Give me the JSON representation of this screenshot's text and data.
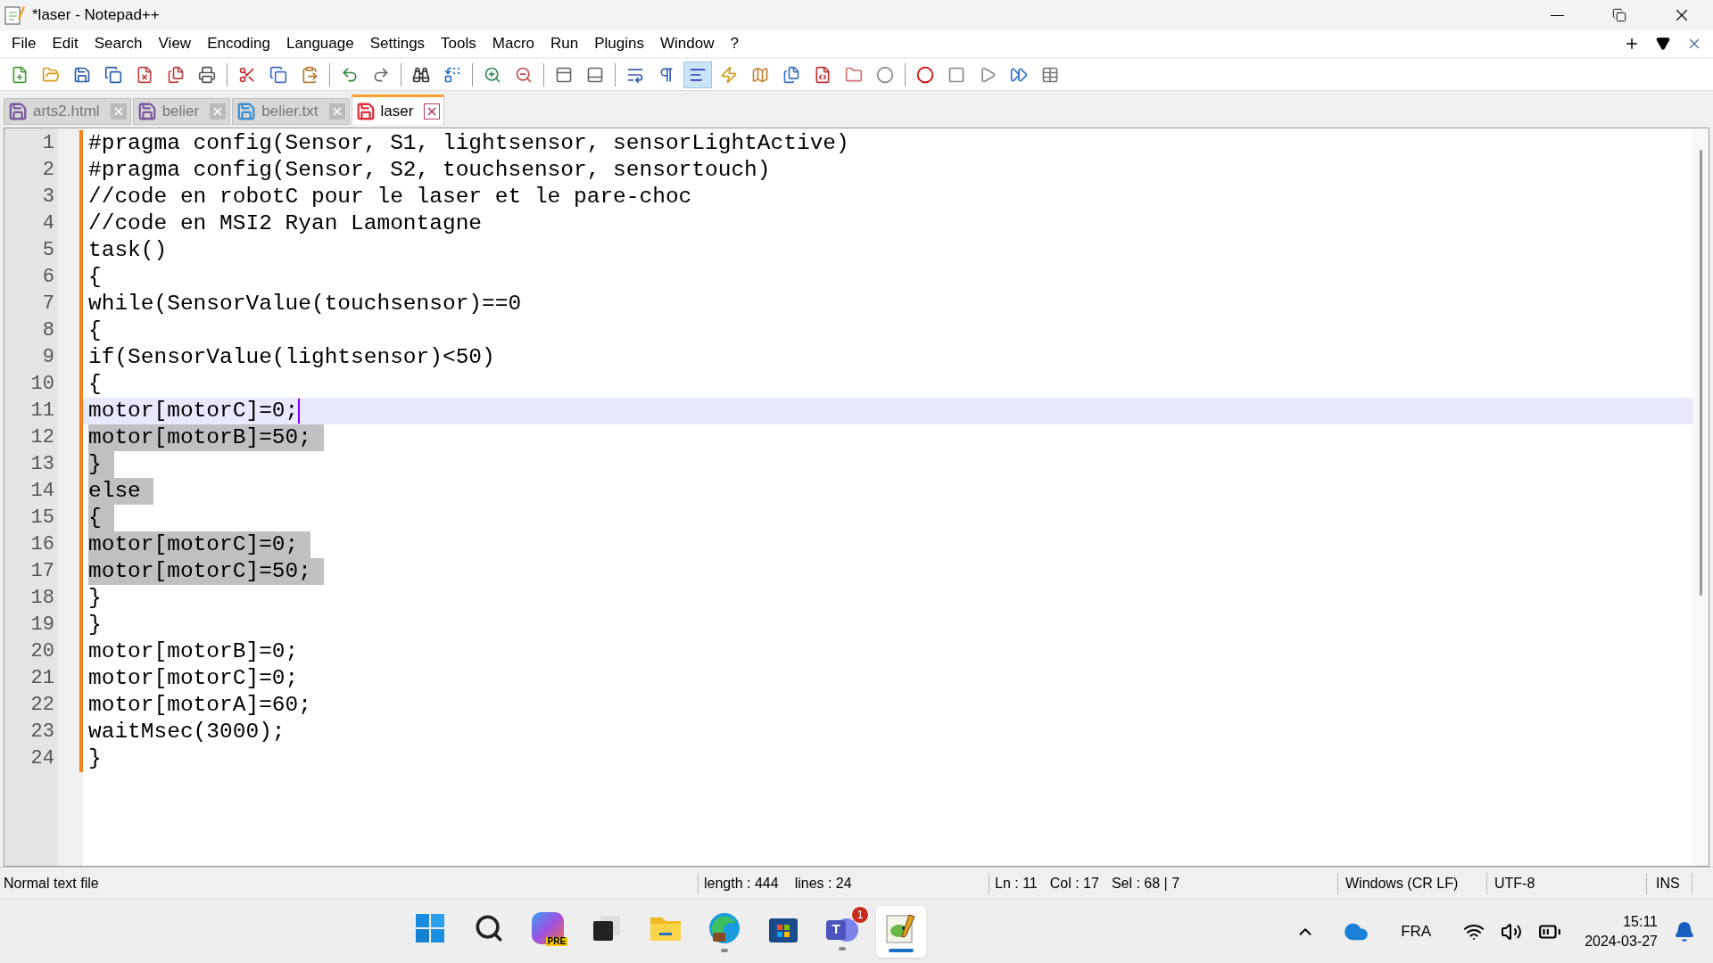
{
  "window": {
    "title": "*laser - Notepad++"
  },
  "menu": [
    "File",
    "Edit",
    "Search",
    "View",
    "Encoding",
    "Language",
    "Settings",
    "Tools",
    "Macro",
    "Run",
    "Plugins",
    "Window",
    "?"
  ],
  "toolbar": [
    {
      "kind": "button",
      "pressed": false
    },
    {
      "kind": "button",
      "pressed": false
    },
    {
      "kind": "button",
      "pressed": false
    },
    {
      "kind": "button",
      "pressed": false
    },
    {
      "kind": "button",
      "pressed": false
    },
    {
      "kind": "button",
      "pressed": false
    },
    {
      "kind": "button",
      "pressed": false
    },
    {
      "kind": "separator"
    },
    {
      "kind": "button",
      "pressed": false
    },
    {
      "kind": "button",
      "pressed": false
    },
    {
      "kind": "button",
      "pressed": false
    },
    {
      "kind": "separator"
    },
    {
      "kind": "button",
      "pressed": false
    },
    {
      "kind": "button",
      "pressed": false
    },
    {
      "kind": "separator"
    },
    {
      "kind": "button",
      "pressed": false
    },
    {
      "kind": "button",
      "pressed": false
    },
    {
      "kind": "separator"
    },
    {
      "kind": "button",
      "pressed": false
    },
    {
      "kind": "button",
      "pressed": false
    },
    {
      "kind": "separator"
    },
    {
      "kind": "button",
      "pressed": false
    },
    {
      "kind": "button",
      "pressed": false
    },
    {
      "kind": "separator"
    },
    {
      "kind": "button",
      "pressed": false
    },
    {
      "kind": "button",
      "pressed": false
    },
    {
      "kind": "button",
      "pressed": true
    },
    {
      "kind": "button",
      "pressed": false
    },
    {
      "kind": "button",
      "pressed": false
    },
    {
      "kind": "button",
      "pressed": false
    },
    {
      "kind": "button",
      "pressed": false
    },
    {
      "kind": "button",
      "pressed": false
    },
    {
      "kind": "button",
      "pressed": false
    },
    {
      "kind": "separator"
    },
    {
      "kind": "button",
      "pressed": false
    },
    {
      "kind": "button",
      "pressed": false
    },
    {
      "kind": "button",
      "pressed": false
    },
    {
      "kind": "button",
      "pressed": false
    },
    {
      "kind": "button",
      "pressed": false
    }
  ],
  "tabs": [
    {
      "label": "arts2.html",
      "selected": false,
      "color": "#7a5a9e"
    },
    {
      "label": "belier",
      "selected": false,
      "color": "#7a5a9e"
    },
    {
      "label": "belier.txt",
      "selected": false,
      "color": "#3a8fd0"
    },
    {
      "label": "laser",
      "selected": true,
      "color": "#e0303a"
    }
  ],
  "lines": [
    {
      "number": "1",
      "text": "#pragma config(Sensor, S1, lightsensor, sensorLightActive)",
      "selected": false,
      "current": false
    },
    {
      "number": "2",
      "text": "#pragma config(Sensor, S2, touchsensor, sensortouch)",
      "selected": false,
      "current": false
    },
    {
      "number": "3",
      "text": "//code en robotC pour le laser et le pare-choc",
      "selected": false,
      "current": false
    },
    {
      "number": "4",
      "text": "//code en MSI2 Ryan Lamontagne",
      "selected": false,
      "current": false
    },
    {
      "number": "5",
      "text": "task()",
      "selected": false,
      "current": false
    },
    {
      "number": "6",
      "text": "{",
      "selected": false,
      "current": false
    },
    {
      "number": "7",
      "text": "while(SensorValue(touchsensor)==0",
      "selected": false,
      "current": false
    },
    {
      "number": "8",
      "text": "{",
      "selected": false,
      "current": false
    },
    {
      "number": "9",
      "text": "if(SensorValue(lightsensor)<50)",
      "selected": false,
      "current": false
    },
    {
      "number": "10",
      "text": "{",
      "selected": false,
      "current": false
    },
    {
      "number": "11",
      "text": "motor[motorC]=0;",
      "selected": false,
      "current": true
    },
    {
      "number": "12",
      "text": "motor[motorB]=50;",
      "selected": true,
      "current": false
    },
    {
      "number": "13",
      "text": "}",
      "selected": true,
      "current": false
    },
    {
      "number": "14",
      "text": "else",
      "selected": true,
      "current": false
    },
    {
      "number": "15",
      "text": "{",
      "selected": true,
      "current": false
    },
    {
      "number": "16",
      "text": "motor[motorC]=0;",
      "selected": true,
      "current": false
    },
    {
      "number": "17",
      "text": "motor[motorC]=50;",
      "selected": true,
      "current": false
    },
    {
      "number": "18",
      "text": "}",
      "selected": false,
      "current": false
    },
    {
      "number": "19",
      "text": "}",
      "selected": false,
      "current": false
    },
    {
      "number": "20",
      "text": "motor[motorB]=0;",
      "selected": false,
      "current": false
    },
    {
      "number": "21",
      "text": "motor[motorC]=0;",
      "selected": false,
      "current": false
    },
    {
      "number": "22",
      "text": "motor[motorA]=60;",
      "selected": false,
      "current": false
    },
    {
      "number": "23",
      "text": "waitMsec(3000);",
      "selected": false,
      "current": false
    },
    {
      "number": "24",
      "text": "}",
      "selected": false,
      "current": false
    }
  ],
  "status_bar": {
    "file_type": "Normal text file",
    "length": "length : 444",
    "lines": "lines : 24",
    "ln": "Ln : 11",
    "col": "Col : 17",
    "sel": "Sel : 68 | 7",
    "eol": "Windows (CR LF)",
    "encoding": "UTF-8",
    "mode": "INS"
  },
  "taskbar": {
    "apps": [
      {
        "kind": "start",
        "running": false,
        "active": false
      },
      {
        "kind": "search",
        "running": false,
        "active": false
      },
      {
        "kind": "copilot",
        "label": "PRE",
        "running": false,
        "active": false
      },
      {
        "kind": "taskview",
        "running": false,
        "active": false
      },
      {
        "kind": "explorer",
        "running": false,
        "active": false
      },
      {
        "kind": "edge",
        "running": true,
        "active": false
      },
      {
        "kind": "store",
        "running": false,
        "active": false
      },
      {
        "kind": "teams",
        "label": "T",
        "badge": "1",
        "running": true,
        "active": false
      },
      {
        "kind": "notepadpp",
        "running": true,
        "active": true
      }
    ],
    "language": "FRA",
    "time": "15:11",
    "date": "2024-03-27"
  }
}
